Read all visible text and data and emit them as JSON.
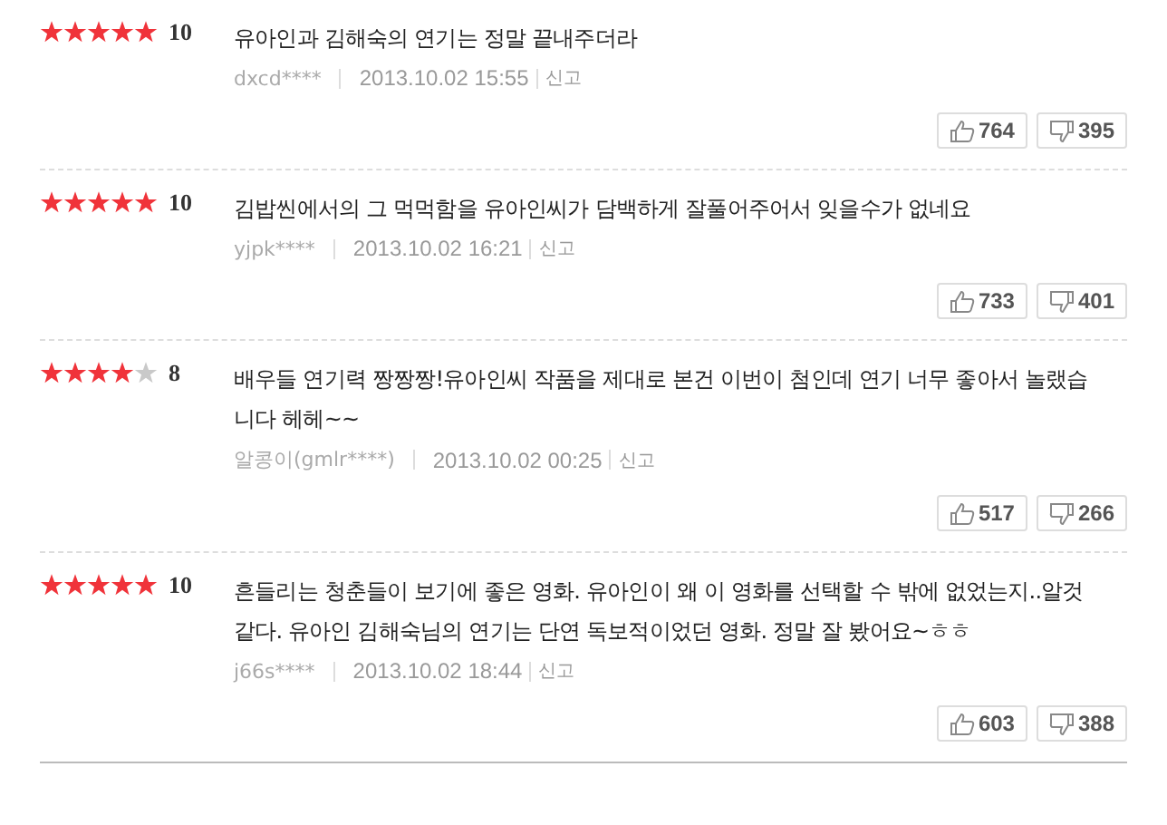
{
  "reviews": [
    {
      "stars": 5,
      "score": "10",
      "text": "유아인과 김해숙의 연기는 정말 끝내주더라",
      "user": "dxcd****",
      "date": "2013.10.02 15:55",
      "report": "신고",
      "likes": "764",
      "dislikes": "395"
    },
    {
      "stars": 5,
      "score": "10",
      "text": "김밥씬에서의 그 먹먹함을 유아인씨가 담백하게 잘풀어주어서 잊을수가 없네요",
      "user": "yjpk****",
      "date": "2013.10.02 16:21",
      "report": "신고",
      "likes": "733",
      "dislikes": "401"
    },
    {
      "stars": 4,
      "score": "8",
      "text": "배우들 연기력 짱짱짱!유아인씨 작품을 제대로 본건 이번이 첨인데 연기 너무 좋아서 놀랬습니다 헤헤~~",
      "user": "알콩이(gmlr****)",
      "date": "2013.10.02 00:25",
      "report": "신고",
      "likes": "517",
      "dislikes": "266"
    },
    {
      "stars": 5,
      "score": "10",
      "text": "흔들리는 청춘들이 보기에 좋은 영화. 유아인이 왜 이 영화를 선택할 수 밖에 없었는지..알것 같다. 유아인 김해숙님의 연기는 단연 독보적이었던 영화. 정말 잘 봤어요~ㅎㅎ",
      "user": "j66s****",
      "date": "2013.10.02 18:44",
      "report": "신고",
      "likes": "603",
      "dislikes": "388"
    }
  ]
}
